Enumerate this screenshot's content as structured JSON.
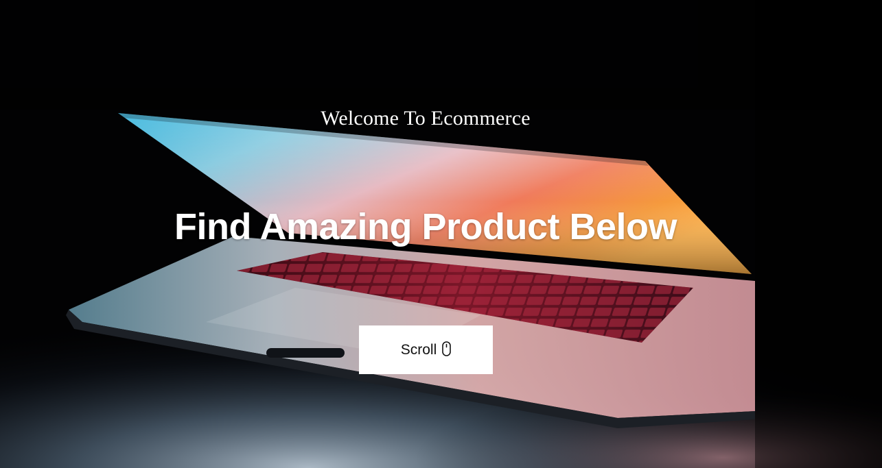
{
  "hero": {
    "welcome_text": "Welcome To Ecommerce",
    "headline": "Find Amazing Product Below",
    "scroll_button": {
      "label": "Scroll",
      "icon": "mouse-icon"
    },
    "background": {
      "description_icon": "laptop-background-image"
    }
  },
  "colors": {
    "background": "#020203",
    "text": "#ffffff",
    "button_bg": "#ffffff",
    "button_text": "#111111"
  }
}
